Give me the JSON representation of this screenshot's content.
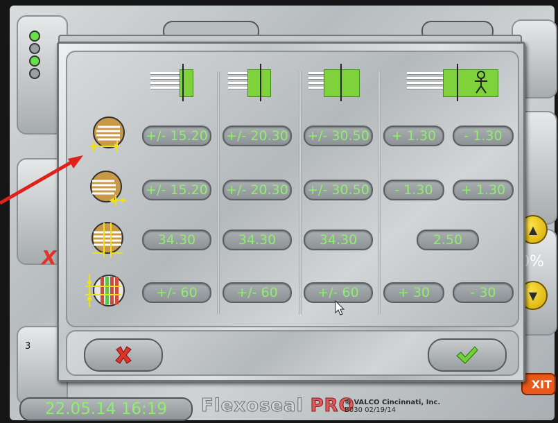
{
  "background": {
    "leds": [
      "on",
      "off",
      "on",
      "off"
    ],
    "side_number": "3",
    "percent_partial": "0%",
    "exit_label": "XIT"
  },
  "dialog": {
    "columns": [
      {
        "icon": "single-tray-icon"
      },
      {
        "icon": "double-tray-icon"
      },
      {
        "icon": "triple-tray-icon"
      },
      {
        "icon": "tray-with-operator-icon"
      }
    ],
    "rows": [
      {
        "icon": "horizontal-offset-right-icon",
        "values": [
          "+/- 15.20",
          "+/- 20.30",
          "+/- 30.50",
          "+ 1.30",
          "- 1.30"
        ]
      },
      {
        "icon": "horizontal-offset-left-icon",
        "values": [
          "+/- 15.20",
          "+/- 20.30",
          "+/- 30.50",
          "- 1.30",
          "+ 1.30"
        ]
      },
      {
        "icon": "width-gap-icon",
        "values": [
          "34.30",
          "34.30",
          "34.30",
          "2.50"
        ]
      },
      {
        "icon": "vertical-offset-icon",
        "values": [
          "+/- 60",
          "+/- 60",
          "+/- 60",
          "+ 30",
          "- 30"
        ]
      }
    ],
    "cancel_icon": "red-x-icon",
    "confirm_icon": "green-check-icon"
  },
  "status": {
    "datetime": "22.05.14 16:19",
    "brand_part1": "Flexoseal",
    "brand_part2": "PRO",
    "company": "© VALCO Cincinnati, Inc.",
    "version": "B030 02/19/14"
  },
  "colors": {
    "value_text": "#8ef06a",
    "accent_green": "#7fd23b",
    "annotation_red": "#e0201a"
  }
}
